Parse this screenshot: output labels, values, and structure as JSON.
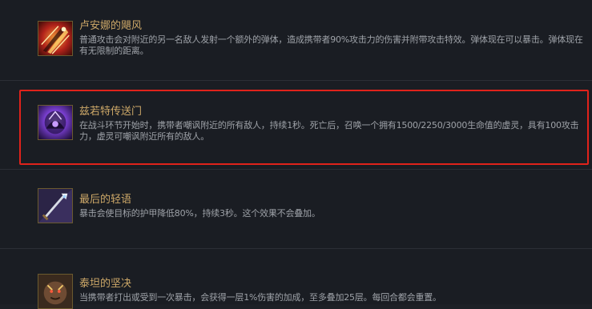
{
  "items": [
    {
      "title": "卢安娜的飓风",
      "description": "普通攻击会对附近的另一名敌人发射一个额外的弹体，造成携带者90%攻击力的伤害并附带攻击特效。弹体现在可以暴击。弹体现在有无限制的距离。",
      "icon": "runaans-hurricane-icon"
    },
    {
      "title": "兹若特传送门",
      "description": "在战斗环节开始时，携带者嘲讽附近的所有敌人，持续1秒。死亡后，召唤一个拥有1500/2250/3000生命值的虚灵，具有100攻击力，虚灵可嘲讽附近所有的敌人。",
      "icon": "zzrot-portal-icon"
    },
    {
      "title": "最后的轻语",
      "description": "暴击会使目标的护甲降低80%，持续3秒。这个效果不会叠加。",
      "icon": "last-whisper-icon"
    },
    {
      "title": "泰坦的坚决",
      "description": "当携带者打出或受到一次暴击，会获得一层1%伤害的加成，至多叠加25层。每回合都会重置。",
      "icon": "titans-resolve-icon"
    }
  ],
  "highlight_color": "#e0221b",
  "title_color": "#cda868",
  "description_color": "#9ea2a8"
}
